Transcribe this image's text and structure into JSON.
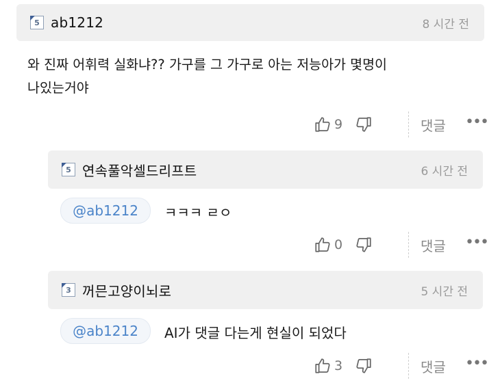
{
  "comments": [
    {
      "badge": "5",
      "nickname": "ab1212",
      "time": "8 시간 전",
      "text_lines": [
        "와 진짜 어휘력 실화냐?? 가구를 그 가구로 아는 저능아가 몇명이",
        "나있는거야"
      ],
      "likes": "9",
      "reply_label": "댓글",
      "more_icon": "more-dots-icon"
    }
  ],
  "replies": [
    {
      "badge": "5",
      "nickname": "연속풀악셀드리프트",
      "time": "6 시간 전",
      "mention": "@ab1212",
      "text": "ㅋㅋㅋ ㄹㅇ",
      "likes": "0",
      "reply_label": "댓글"
    },
    {
      "badge": "3",
      "nickname": "꺼믄고양이뇌로",
      "time": "5 시간 전",
      "mention": "@ab1212",
      "text": "AI가 댓글 다는게 현실이 되었다",
      "likes": "3",
      "reply_label": "댓글"
    }
  ],
  "icons": {
    "like": "thumbs-up-icon",
    "dislike": "thumbs-down-icon",
    "more": "more-dots-icon"
  },
  "colors": {
    "header_bg": "#f0f0f0",
    "mention_text": "#4b84c9",
    "time_text": "#9a9a9a"
  }
}
